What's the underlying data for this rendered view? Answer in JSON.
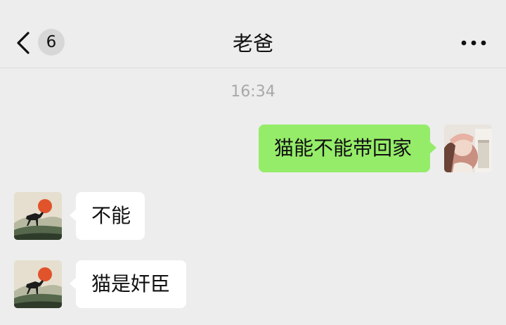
{
  "header": {
    "unread_count": "6",
    "title": "老爸"
  },
  "timestamp": "16:34",
  "messages": [
    {
      "sender": "me",
      "text": "猫能不能带回家"
    },
    {
      "sender": "them",
      "text": "不能"
    },
    {
      "sender": "them",
      "text": "猫是奸臣"
    }
  ],
  "colors": {
    "background": "#ededed",
    "my_bubble": "#95ec69",
    "their_bubble": "#ffffff",
    "timestamp_text": "#a8a8a8"
  },
  "icons": {
    "back": "chevron-left-icon",
    "more": "more-dots-icon"
  }
}
